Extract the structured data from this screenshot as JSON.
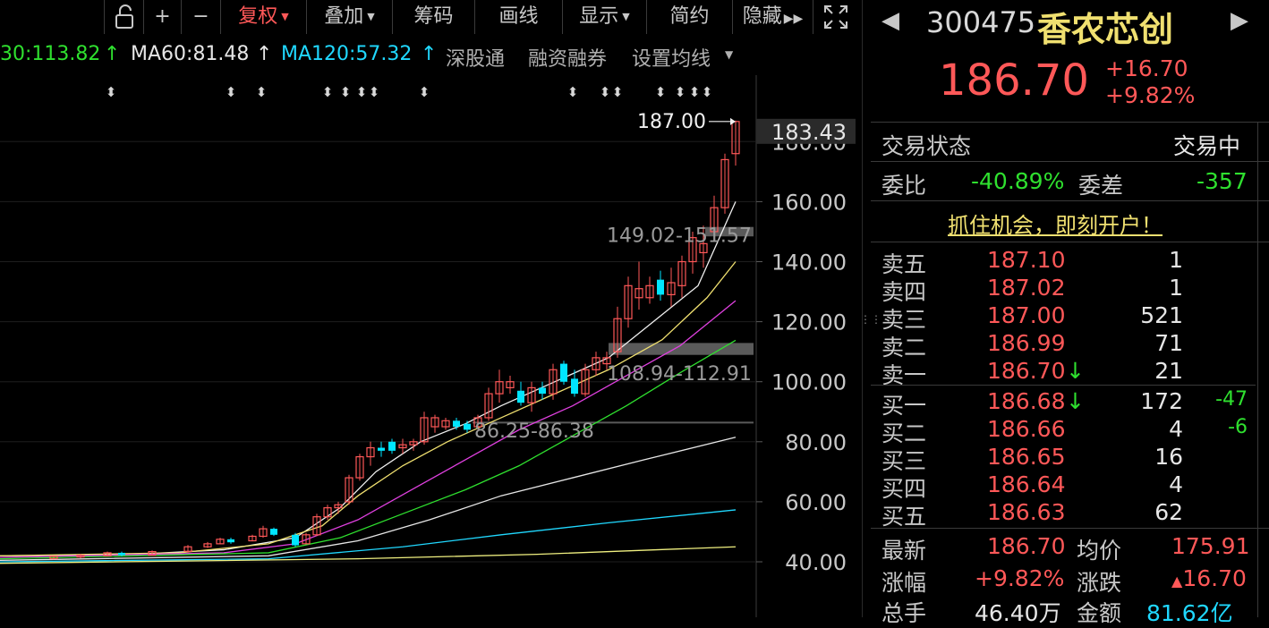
{
  "toolbar": {
    "buttons": [
      "复权",
      "叠加",
      "筹码",
      "画线",
      "显示",
      "简约",
      "隐藏"
    ],
    "active": "复权"
  },
  "ma_line": {
    "ma30": "30:113.82",
    "ma60": "MA60:81.48",
    "ma120": "MA120:57.32",
    "links": [
      "深股通",
      "融资融券",
      "设置均线"
    ]
  },
  "chart_data": {
    "type": "candlestick",
    "price_axis": {
      "ticks": [
        "180.00",
        "160.00",
        "140.00",
        "120.00",
        "100.00",
        "80.00",
        "60.00",
        "40.00"
      ],
      "current": "183.43"
    },
    "annotations": {
      "high_label": "187.00",
      "gap_top": "149.02-151.57",
      "gap_mid": "108.94-112.91",
      "gap_low": "86.25-86.38"
    },
    "colors": {
      "up": "#ff5858",
      "down": "#00e5ff"
    }
  },
  "quote": {
    "code": "300475",
    "name": "香农芯创",
    "price": "186.70",
    "change": "+16.70",
    "change_pct": "+9.82%",
    "status_label": "交易状态",
    "status_value": "交易中",
    "wb_label": "委比",
    "wb_value": "-40.89%",
    "wc_label": "委差",
    "wc_value": "-357",
    "promo": "抓住机会，即刻开户！",
    "asks": [
      {
        "label": "卖五",
        "price": "187.10",
        "vol": "1"
      },
      {
        "label": "卖四",
        "price": "187.02",
        "vol": "1"
      },
      {
        "label": "卖三",
        "price": "187.00",
        "vol": "521"
      },
      {
        "label": "卖二",
        "price": "186.99",
        "vol": "71"
      },
      {
        "label": "卖一",
        "price": "186.70",
        "vol": "21"
      }
    ],
    "bids": [
      {
        "label": "买一",
        "price": "186.68",
        "vol": "172",
        "chg": "-47"
      },
      {
        "label": "买二",
        "price": "186.66",
        "vol": "4",
        "chg": "-6"
      },
      {
        "label": "买三",
        "price": "186.65",
        "vol": "16",
        "chg": ""
      },
      {
        "label": "买四",
        "price": "186.64",
        "vol": "4",
        "chg": ""
      },
      {
        "label": "买五",
        "price": "186.63",
        "vol": "62",
        "chg": ""
      }
    ],
    "stats": {
      "latest_label": "最新",
      "latest_value": "186.70",
      "avg_label": "均价",
      "avg_value": "175.91",
      "pct_label": "涨幅",
      "pct_value": "+9.82%",
      "chg_label": "涨跌",
      "chg_value": "16.70",
      "vol_label": "总手",
      "vol_value": "46.40万",
      "amt_label": "金额",
      "amt_value": "81.62亿"
    }
  }
}
